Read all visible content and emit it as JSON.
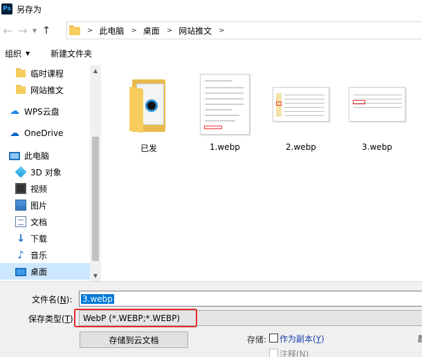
{
  "window": {
    "app_icon_text": "Ps",
    "title": "另存为"
  },
  "nav": {
    "back_icon": "arrow-left-icon",
    "forward_icon": "arrow-right-icon",
    "up_icon": "arrow-up-icon",
    "breadcrumbs": [
      "此电脑",
      "桌面",
      "网站推文"
    ]
  },
  "toolbar": {
    "organize_label": "组织",
    "new_folder_label": "新建文件夹"
  },
  "sidebar": {
    "items": [
      {
        "label": "临时课程",
        "icon": "folder-icon"
      },
      {
        "label": "网站推文",
        "icon": "folder-icon"
      },
      {
        "label": "WPS云盘",
        "icon": "wps-cloud-icon"
      },
      {
        "label": "OneDrive",
        "icon": "onedrive-icon"
      },
      {
        "label": "此电脑",
        "icon": "computer-icon"
      },
      {
        "label": "3D 对象",
        "icon": "3d-objects-icon"
      },
      {
        "label": "视频",
        "icon": "video-icon"
      },
      {
        "label": "图片",
        "icon": "pictures-icon"
      },
      {
        "label": "文档",
        "icon": "documents-icon"
      },
      {
        "label": "下载",
        "icon": "download-icon"
      },
      {
        "label": "音乐",
        "icon": "music-icon"
      },
      {
        "label": "桌面",
        "icon": "desktop-icon",
        "selected": true
      }
    ]
  },
  "files": [
    {
      "name": "已发",
      "type": "folder"
    },
    {
      "name": "1.webp",
      "type": "image"
    },
    {
      "name": "2.webp",
      "type": "image"
    },
    {
      "name": "3.webp",
      "type": "image"
    }
  ],
  "form": {
    "filename_label": "文件名(N):",
    "filename_label_main": "文件名(",
    "filename_label_key": "N",
    "filename_label_end": "):",
    "filename_value": "3.webp",
    "filetype_label_main": "保存类型(",
    "filetype_label_key": "T",
    "filetype_label_end": ")",
    "filetype_value": "WebP (*.WEBP;*.WEBP)",
    "cloud_button": "存储到云文档",
    "store_label": "存储:",
    "copy_label_main": "作为副本(",
    "copy_label_key": "Y",
    "copy_label_end": ")",
    "note_label_main": "注释(",
    "note_label_key": "N",
    "note_label_end": ")",
    "edge_text": "颜"
  },
  "colors": {
    "selection": "#cce8ff",
    "highlight_outline": "#e52a2a",
    "input_selection": "#0078d7"
  }
}
